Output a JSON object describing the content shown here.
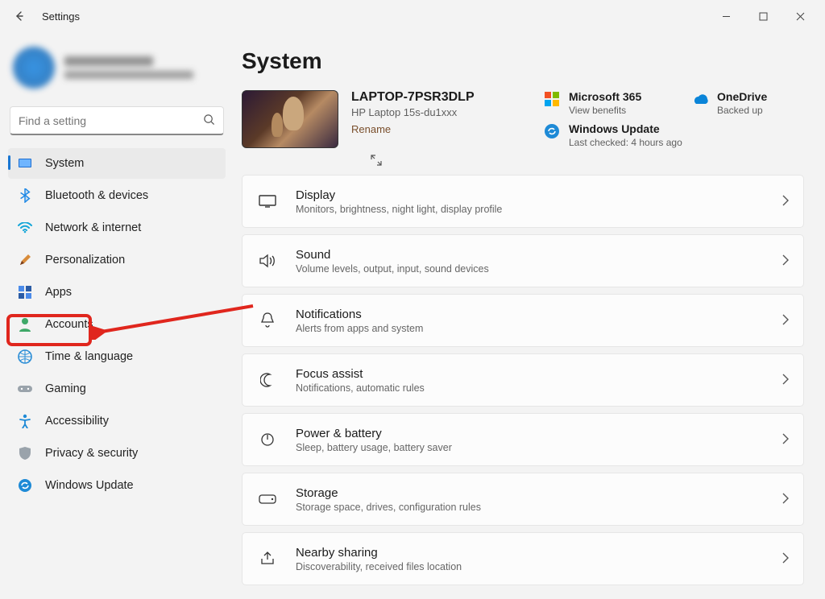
{
  "titlebar": {
    "title": "Settings"
  },
  "search": {
    "placeholder": "Find a setting"
  },
  "sidebar": {
    "items": [
      {
        "label": "System"
      },
      {
        "label": "Bluetooth & devices"
      },
      {
        "label": "Network & internet"
      },
      {
        "label": "Personalization"
      },
      {
        "label": "Apps"
      },
      {
        "label": "Accounts"
      },
      {
        "label": "Time & language"
      },
      {
        "label": "Gaming"
      },
      {
        "label": "Accessibility"
      },
      {
        "label": "Privacy & security"
      },
      {
        "label": "Windows Update"
      }
    ]
  },
  "main": {
    "heading": "System",
    "device": {
      "name": "LAPTOP-7PSR3DLP",
      "model": "HP Laptop 15s-du1xxx",
      "rename": "Rename"
    },
    "status": {
      "ms365": {
        "title": "Microsoft 365",
        "sub": "View benefits"
      },
      "onedrive": {
        "title": "OneDrive",
        "sub": "Backed up"
      },
      "update": {
        "title": "Windows Update",
        "sub": "Last checked: 4 hours ago"
      }
    },
    "cards": [
      {
        "title": "Display",
        "desc": "Monitors, brightness, night light, display profile"
      },
      {
        "title": "Sound",
        "desc": "Volume levels, output, input, sound devices"
      },
      {
        "title": "Notifications",
        "desc": "Alerts from apps and system"
      },
      {
        "title": "Focus assist",
        "desc": "Notifications, automatic rules"
      },
      {
        "title": "Power & battery",
        "desc": "Sleep, battery usage, battery saver"
      },
      {
        "title": "Storage",
        "desc": "Storage space, drives, configuration rules"
      },
      {
        "title": "Nearby sharing",
        "desc": "Discoverability, received files location"
      }
    ]
  }
}
